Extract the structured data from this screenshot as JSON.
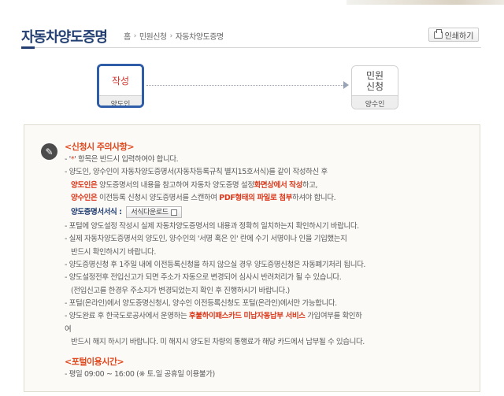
{
  "header": {
    "title": "자동차양도증명",
    "breadcrumb": [
      "홈",
      "민원신청",
      "자동차양도증명"
    ],
    "print_label": "인쇄하기"
  },
  "steps": [
    {
      "label": "작성",
      "sub": "양도인",
      "active": true
    },
    {
      "label": "민원\n신청",
      "sub": "양수인",
      "active": false
    }
  ],
  "notice": {
    "title1": "<신청시 주의사항>",
    "l1a": "- '",
    "l1b": "*",
    "l1c": "' 항목은 반드시 입력하여야 합니다.",
    "l2": "- 양도인, 양수인이 자동차양도증명서(자동차등록규칙 별지15호서식)를 같이 작성하신 후",
    "l3a": "양도인은",
    "l3b": " 양도증명서의 내용을 참고하여 자동차 양도증명 설정",
    "l3c": "화면상에서 작성",
    "l3d": "하고,",
    "l4a": "양수인은",
    "l4b": " 이전등록 신청시 양도증명서를 스캔하여 ",
    "l4c": "PDF형태의 파일로 첨부",
    "l4d": "하셔야 합니다.",
    "form_label": "양도증명서서식 :",
    "download_label": "서식다운로드",
    "l5": "- 포털에 양도설정 작성시 실제 자동차양도증명서의 내용과 정확히 일치하는지 확인하시기 바랍니다.",
    "l6": "- 실제 자동차양도증명서의 양도인, 양수인의 '서명 혹은 인' 란에 수기 서명이나 인을 기입했는지",
    "l7": "반드시 확인하시기 바랍니다.",
    "l8": "- 양도증명신청 후 1주일 내에 이전등록신청을 하지 않으실 경우 양도증명신청은 자동폐기처리 됩니다.",
    "l9": "- 양도설정전후 전입신고가 되면 주소가 자동으로 변경되어 심사시 반려처리가 될 수 있습니다.",
    "l10": "(전입신고를 한경우 주소지가 변경되었는지 확인 후 진행하시기 바랍니다.)",
    "l11": "- 포털(온라인)에서 양도증명신청시, 양수인 이전등록신청도 포털(온라인)에서만 가능합니다.",
    "l12a": "- 양도완료 후 한국도로공사에서 운영하는 ",
    "l12b": "후불하이패스카드 미납자동납부 서비스",
    "l12c": " 가입여부를 확인하",
    "l13": "여",
    "l14": "반드시 해지 하시기 바랍니다. 미 해지시 양도된 차량의 통행료가 해당 카드에서 납부될 수 있습니다.",
    "title2": "<포털이용시간>",
    "hours": "- 평일 09:00 ~ 16:00 (※ 토.일 공휴일 이용불가)"
  },
  "colors": {
    "brand": "#233f72",
    "accent_red": "#d93b1f",
    "title_orange": "#e1481d"
  }
}
